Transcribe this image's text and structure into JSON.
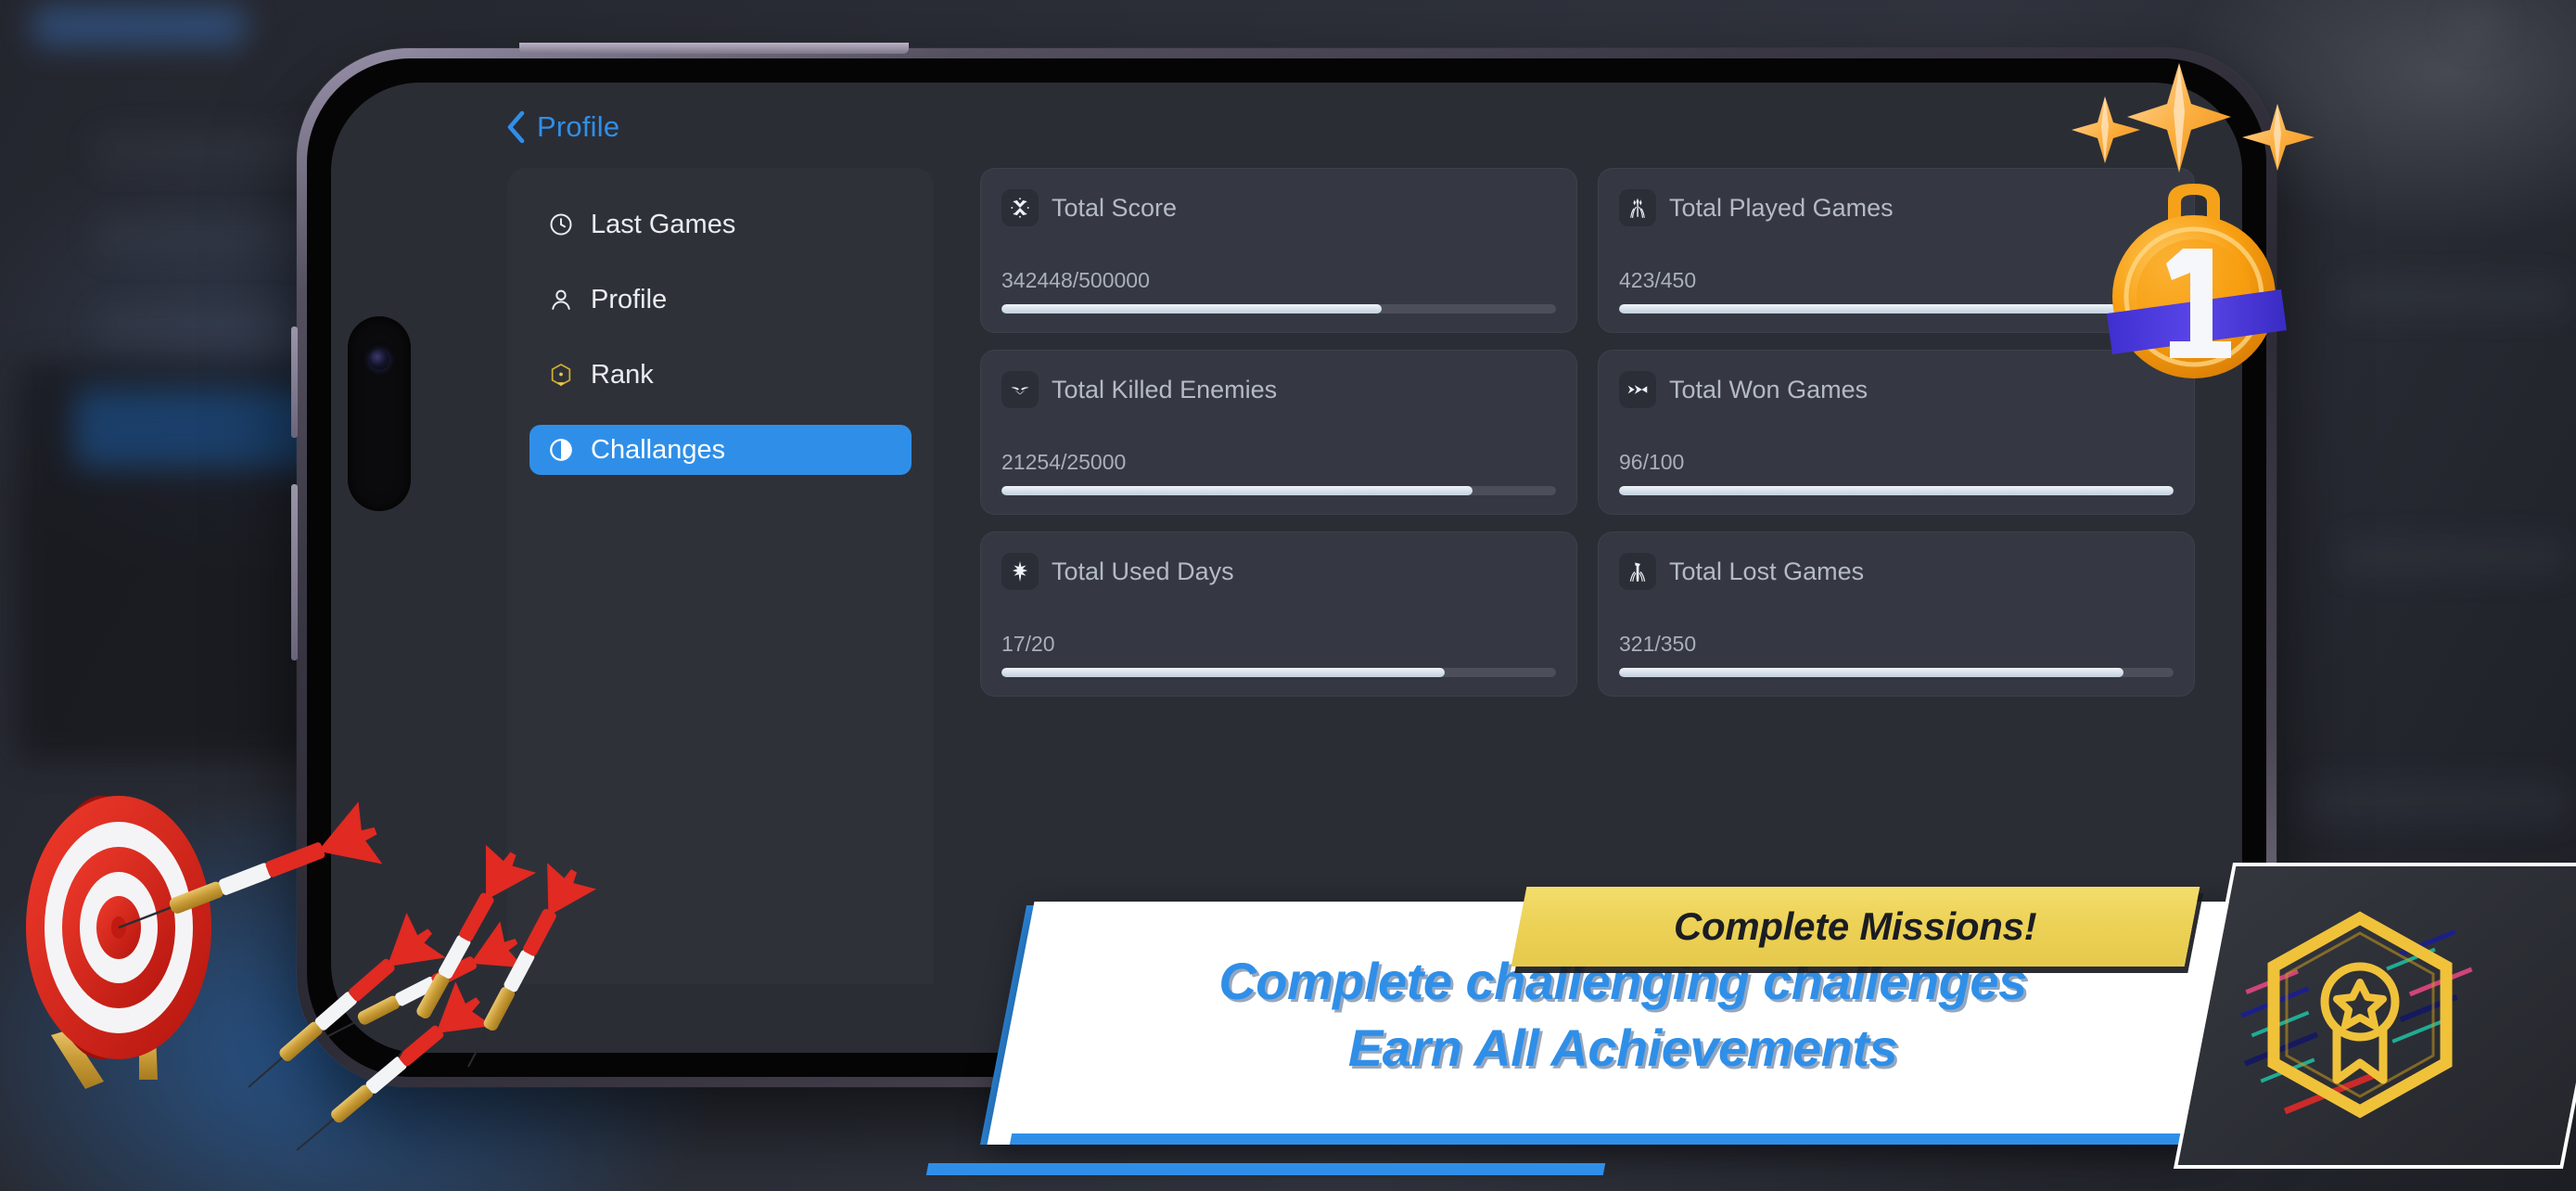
{
  "app": {
    "nav": {
      "back_label": "Profile",
      "back_icon": "chevron-left-icon"
    },
    "sidebar": {
      "items": [
        {
          "label": "Last Games",
          "icon": "clock-icon",
          "active": false
        },
        {
          "label": "Profile",
          "icon": "user-icon",
          "active": false
        },
        {
          "label": "Rank",
          "icon": "hexagon-rank-icon",
          "active": false
        },
        {
          "label": "Challanges",
          "icon": "half-moon-icon",
          "active": true
        }
      ]
    },
    "stats": {
      "cards": [
        {
          "title": "Total Score",
          "icon": "crossed-flags-icon",
          "value": "342448/500000",
          "current": 342448,
          "max": 500000,
          "percent": 68.5
        },
        {
          "title": "Total Played Games",
          "icon": "arrows-quiver-icon",
          "value": "423/450",
          "current": 423,
          "max": 450,
          "percent": 94.0
        },
        {
          "title": "Total Killed Enemies",
          "icon": "evil-eyes-icon",
          "value": "21254/25000",
          "current": 21254,
          "max": 25000,
          "percent": 85.0
        },
        {
          "title": "Total Won Games",
          "icon": "arrow-dart-icon",
          "value": "96/100",
          "current": 96,
          "max": 100,
          "percent": 100.0
        },
        {
          "title": "Total Used Days",
          "icon": "star-blade-icon",
          "value": "17/20",
          "current": 17,
          "max": 20,
          "percent": 80.0
        },
        {
          "title": "Total Lost Games",
          "icon": "broken-sword-icon",
          "value": "321/350",
          "current": 321,
          "max": 350,
          "percent": 91.0
        }
      ]
    }
  },
  "banner": {
    "ribbon_label": "Complete Missions!",
    "headline_line1": "Complete challenging challenges",
    "headline_line2": "Earn All Achievements",
    "badge_icon": "hexagon-award-icon"
  },
  "decorations": {
    "medal_icon": "gold-medal-first-place-icon",
    "medal_number": "1",
    "stars_icon": "sparkle-star-icon",
    "dartboard_icon": "dartboard-target-icon",
    "darts_icon": "dart-icon"
  },
  "colors": {
    "accent_blue": "#2f8fe8",
    "ribbon_yellow": "#ecd257",
    "card_bg": "#353842",
    "sidebar_bg": "#2f3139",
    "screen_bg": "#2b2d35",
    "progress_fill": "#dce5ef",
    "progress_track": "#4c4f59",
    "gold": "#f0c23a",
    "dart_red": "#e02a22"
  }
}
